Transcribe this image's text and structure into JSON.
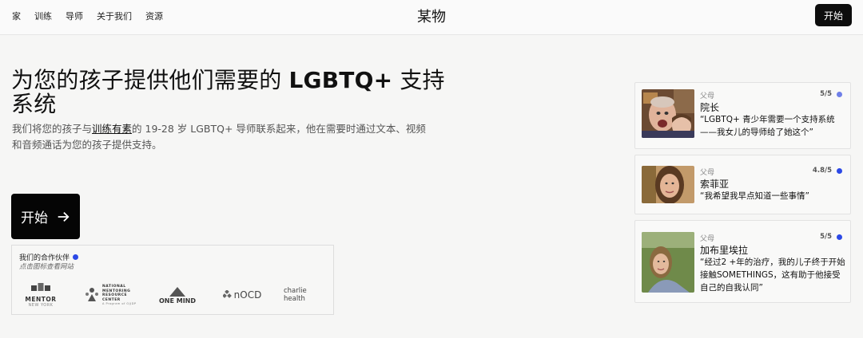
{
  "nav": {
    "links": [
      "家",
      "训练",
      "导师",
      "关于我们",
      "资源"
    ],
    "brand": "某物",
    "cta": "开始"
  },
  "hero": {
    "title_part1": "为您的孩子提供他们需要的 ",
    "title_bold": "LGBTQ+",
    "title_part2": " 支持系统",
    "desc_part1": "我们将您的孩子与",
    "desc_link": "训练有素",
    "desc_part2": "的 19-28 岁 LGBTQ+ 导师联系起来，他在需要时通过文本、视频和音频通话为您的孩子提供支持。",
    "cta": "开始"
  },
  "partners": {
    "title": "我们的合作伙伴",
    "hint": "点击图标查看网站",
    "logos": [
      {
        "name": "MENTOR",
        "sub": "NEW YORK"
      },
      {
        "name": "NATIONAL MENTORING RESOURCE CENTER",
        "sub": "A Program of OJJDP"
      },
      {
        "name": "ONE MIND"
      },
      {
        "name": "nOCD"
      },
      {
        "name": "charlie health"
      }
    ]
  },
  "testimonials": [
    {
      "role": "父母",
      "name": "院长",
      "rating": "5/5",
      "quote": "“LGBTQ+ 青少年需要一个支持系统——我女儿的导师给了她这个”"
    },
    {
      "role": "父母",
      "name": "索菲亚",
      "rating": "4.8/5",
      "quote": "“我希望我早点知道一些事情”"
    },
    {
      "role": "父母",
      "name": "加布里埃拉",
      "rating": "5/5",
      "quote": "“经过2 +年的治疗，我的儿子终于开始接触SOMETHINGS，这有助于他接受自己的自我认同”"
    }
  ],
  "colors": {
    "accent": "#2c49e6",
    "dark": "#0d0d0d"
  }
}
